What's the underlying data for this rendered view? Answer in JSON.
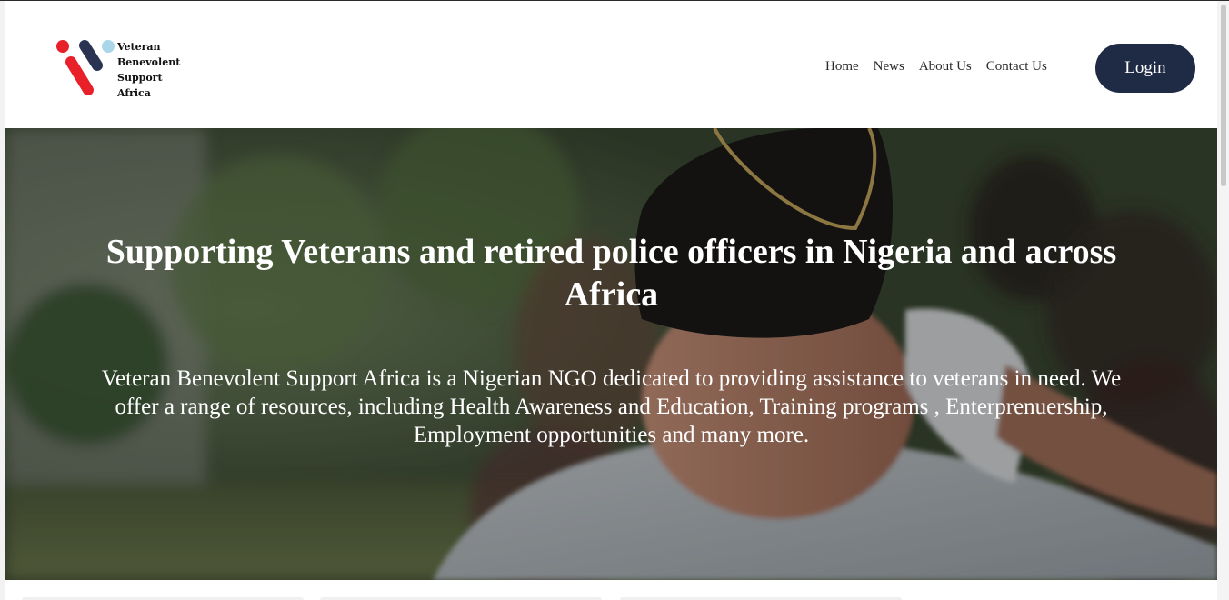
{
  "header": {
    "logo": {
      "lines": [
        "Veteran",
        "Benevolent",
        "Support",
        "Africa"
      ],
      "colors": {
        "red": "#e8202a",
        "navy": "#2a3352",
        "lightblue": "#a9d6e8"
      }
    },
    "nav": [
      {
        "label": "Home"
      },
      {
        "label": "News"
      },
      {
        "label": "About Us"
      },
      {
        "label": "Contact Us"
      }
    ],
    "login_label": "Login",
    "login_color": "#1f2a44"
  },
  "hero": {
    "title": "Supporting Veterans and retired police officers in Nigeria and across Africa",
    "description": "Veteran Benevolent Support Africa is a Nigerian NGO dedicated to providing assistance to veterans in need. We offer a range of resources, including Health Awareness and Education, Training programs , Enterprenuership, Employment opportunities and many more.",
    "image": "veteran-saluting-photo"
  }
}
